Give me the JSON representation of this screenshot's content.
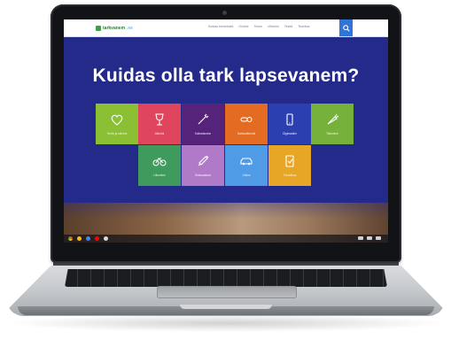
{
  "site": {
    "logo_text": "tarkvanem",
    "logo_tld": ".ee",
    "nav": [
      "Kuidas toimetulek",
      "Oluline",
      "Teave",
      "Viktoriin",
      "Testid",
      "Teavitus"
    ],
    "search_icon": "search-icon"
  },
  "hero": {
    "title": "Kuidas olla tark lapsevanem?"
  },
  "tiles": [
    {
      "label": "Tervis ja vaimne",
      "color": "#8bbf34",
      "icon": "heart-icon"
    },
    {
      "label": "Alkohol",
      "color": "#e0455e",
      "icon": "wine-glass-icon"
    },
    {
      "label": "Suitsetamine",
      "color": "#55247a",
      "icon": "cigarette-icon"
    },
    {
      "label": "Narkootikumid",
      "color": "#e46b22",
      "icon": "pills-icon"
    },
    {
      "label": "Digimaailm",
      "color": "#2c3fb1",
      "icon": "phone-icon"
    },
    {
      "label": "Toitumine",
      "color": "#76b13c",
      "icon": "carrot-icon"
    },
    {
      "label": "Liikumine",
      "color": "#3f9a5e",
      "icon": "bicycle-icon"
    },
    {
      "label": "Seksuaalsus",
      "color": "#b07ac9",
      "icon": "syringe-icon"
    },
    {
      "label": "Liiklus",
      "color": "#4f9be6",
      "icon": "car-icon"
    },
    {
      "label": "Turvalisus",
      "color": "#e8a626",
      "icon": "safety-icon"
    }
  ],
  "taskbar": {
    "apps": [
      {
        "name": "chrome-icon",
        "color": "#ea4335"
      },
      {
        "name": "gmail-icon",
        "color": "#fbbc05"
      },
      {
        "name": "docs-icon",
        "color": "#4285f4"
      },
      {
        "name": "youtube-icon",
        "color": "#ff0000"
      },
      {
        "name": "apps-launcher-icon",
        "color": "#d7d9dd"
      }
    ]
  }
}
